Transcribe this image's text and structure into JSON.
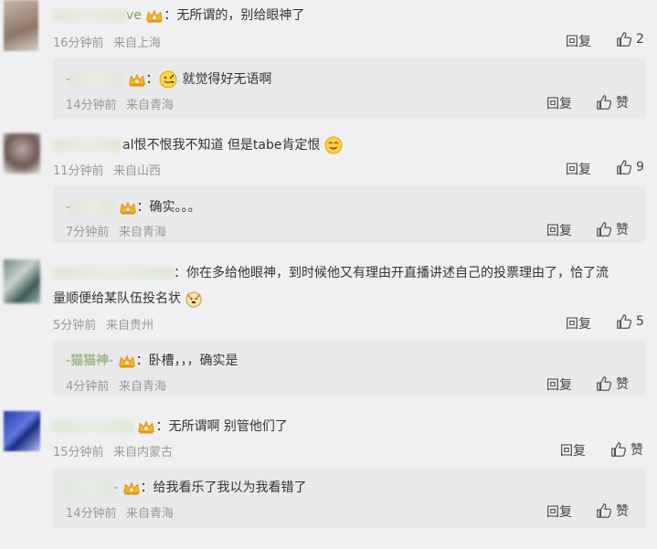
{
  "comments": [
    {
      "text": "：无所谓的，别给眼神了",
      "username_visible": "ve",
      "time": "16分钟前",
      "location": "来自上海",
      "reply_label": "回复",
      "like_count": "2",
      "sub": {
        "text": "：就觉得好无语啊",
        "time": "14分钟前",
        "location": "来自青海",
        "reply_label": "回复",
        "like_label": "赞"
      }
    },
    {
      "text": "al恨不恨我不知道 但是tabe肯定恨",
      "time": "11分钟前",
      "location": "来自山西",
      "reply_label": "回复",
      "like_count": "9",
      "sub": {
        "text": "：确实。。。",
        "time": "7分钟前",
        "location": "来自青海",
        "reply_label": "回复",
        "like_label": "赞"
      }
    },
    {
      "text_line1": "：你在多给他眼神，到时候他又有理由开直播讲述自己的投票理由了，恰了流",
      "text_line2": "量顺便给某队伍投名状",
      "time": "5分钟前",
      "location": "来自贵州",
      "reply_label": "回复",
      "like_count": "5",
      "sub": {
        "username_visible": "-猫猫神-",
        "text": "：卧槽，，，确实是",
        "time": "4分钟前",
        "location": "来自青海",
        "reply_label": "回复",
        "like_label": "赞"
      }
    },
    {
      "text": "：无所谓啊 别管他们了",
      "time": "15分钟前",
      "location": "来自内蒙古",
      "reply_label": "回复",
      "like_label": "赞",
      "sub": {
        "username_visible": "-",
        "text": "：给我看乐了我以为我看错了",
        "time": "14分钟前",
        "location": "来自青海",
        "reply_label": "回复",
        "like_label": "赞"
      }
    }
  ],
  "colors": {
    "bg": "#f0f0f3",
    "sub_bg": "#e9e9ec",
    "username": "#7aa05a",
    "meta": "#999999"
  },
  "icons": [
    "crown-badge-icon",
    "thumbs-up-icon",
    "smile-emoji-icon",
    "yummy-emoji-icon",
    "dog-emoji-icon"
  ]
}
